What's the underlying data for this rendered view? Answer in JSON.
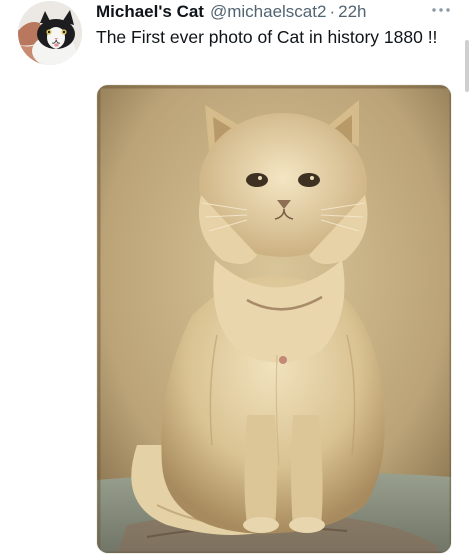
{
  "tweet": {
    "display_name": "Michael's Cat",
    "handle": "@michaelscat2",
    "separator": "·",
    "timestamp": "22h",
    "text": "The First ever photo of Cat in history 1880 !!"
  },
  "icons": {
    "avatar": "cat-avatar",
    "more": "more-options-icon"
  },
  "media": {
    "type": "photo",
    "subject": "vintage-sepia-cat-photo"
  },
  "colors": {
    "text_primary": "#0f1419",
    "text_secondary": "#536471",
    "photo_sepia_light": "#d6c397",
    "photo_sepia_dark": "#6e5a3a"
  }
}
